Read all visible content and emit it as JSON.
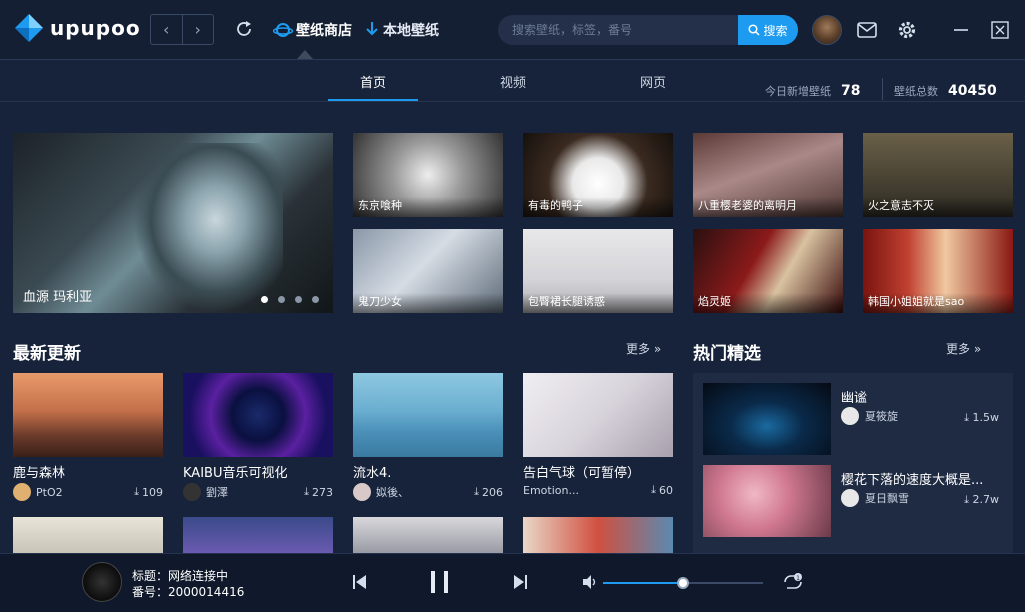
{
  "app": {
    "logo_text": "upupoo"
  },
  "header": {
    "tab_store": "壁纸商店",
    "tab_local": "本地壁纸",
    "search_placeholder": "搜索壁纸，标签，番号",
    "search_button": "搜索"
  },
  "subnav": {
    "tabs": [
      "首页",
      "视频",
      "网页"
    ],
    "active_index": 0,
    "today_label": "今日新增壁纸",
    "today_value": "78",
    "total_label": "壁纸总数",
    "total_value": "40450"
  },
  "banner": {
    "main_label": "血源 玛利亚",
    "dots": 4,
    "active_dot": 0
  },
  "tiles": [
    "东京喰种",
    "有毒的鸭子",
    "八重樱老婆的离明月",
    "火之意志不灭",
    "鬼刀少女",
    "包臀裙长腿诱惑",
    "焰灵姬",
    "韩国小姐姐就是sao"
  ],
  "latest": {
    "title": "最新更新",
    "more": "更多",
    "items": [
      {
        "name": "鹿与森林",
        "author": "PtO2",
        "downloads": "109"
      },
      {
        "name": "KAIBU音乐可视化",
        "author": "劉澤",
        "downloads": "273"
      },
      {
        "name": "流水4.",
        "author": "姒後、",
        "downloads": "206"
      },
      {
        "name": "告白气球（可暂停）",
        "author": "Emotion...",
        "downloads": "60"
      }
    ]
  },
  "hot": {
    "title": "热门精选",
    "more": "更多",
    "items": [
      {
        "name": "幽谧",
        "author": "夏筱旋",
        "downloads": "1.5w"
      },
      {
        "name": "樱花下落的速度大概是...",
        "author": "夏日飘雪",
        "downloads": "2.7w"
      }
    ]
  },
  "player": {
    "title_label": "标题：网络连接中",
    "id_label": "番号：2000014416",
    "volume": 0.5
  },
  "colors": {
    "accent": "#1d9bf0",
    "background": "#17233a"
  }
}
